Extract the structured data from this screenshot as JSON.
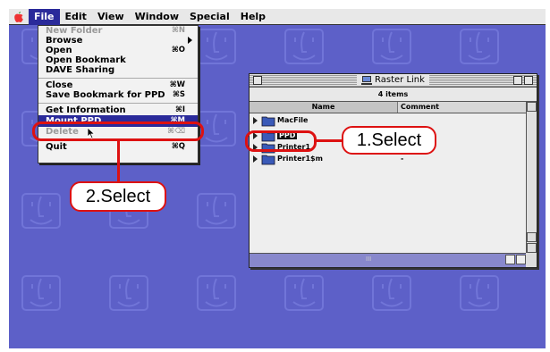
{
  "menubar": {
    "apple_icon": "apple-icon",
    "items": [
      "File",
      "Edit",
      "View",
      "Window",
      "Special",
      "Help"
    ],
    "active": "File"
  },
  "file_menu": {
    "items": [
      {
        "label": "New Folder",
        "shortcut": "⌘N",
        "disabled": true
      },
      {
        "label": "Browse",
        "shortcut": "",
        "submenu": true
      },
      {
        "label": "Open",
        "shortcut": "⌘O"
      },
      {
        "label": "Open Bookmark",
        "shortcut": ""
      },
      {
        "label": "DAVE Sharing",
        "shortcut": ""
      },
      {
        "label": "Close",
        "shortcut": "⌘W"
      },
      {
        "label": "Save Bookmark for  PPD",
        "shortcut": "⌘S"
      },
      {
        "label": "Get Information",
        "shortcut": "⌘I"
      },
      {
        "label": "Mount  PPD",
        "shortcut": "⌘M",
        "highlighted": true
      },
      {
        "label": "Delete",
        "shortcut": "⌘⌫",
        "disabled": true
      },
      {
        "label": "Quit",
        "shortcut": "⌘Q"
      }
    ]
  },
  "window": {
    "title": "Raster Link",
    "item_count": "4 items",
    "columns": {
      "name": "Name",
      "comment": "Comment"
    },
    "rows": [
      {
        "name": "MacFile",
        "comment": ""
      },
      {
        "name": "PPD",
        "comment": ""
      },
      {
        "name": "Printer1",
        "comment": ""
      },
      {
        "name": "Printer1$m",
        "comment": "-"
      }
    ],
    "hscroll_mark": "III"
  },
  "callouts": {
    "step1": "1.Select",
    "step2": "2.Select"
  },
  "colors": {
    "desktop": "#5d60c8",
    "highlight": "#2a2a9a",
    "callout_red": "#d11111"
  }
}
